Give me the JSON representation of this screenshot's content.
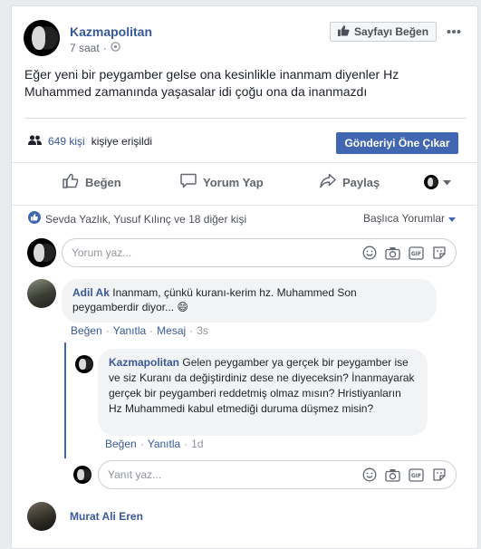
{
  "post": {
    "page_name": "Kazmapolitan",
    "time": "7 saat",
    "privacy_separator": "·",
    "privacy_icon": "globe-icon",
    "like_page_label": "Sayfayı Beğen",
    "more_icon": "more-dots-icon",
    "text": "Eğer yeni bir peygamber gelse ona kesinlikle inanmam diyenler Hz Muhammed zamanında yaşasalar idi çoğu ona da inanmazdı"
  },
  "reach": {
    "count": "649 kişi",
    "suffix": "kişiye erişildi",
    "boost_label": "Gönderiyi Öne Çıkar"
  },
  "actions": {
    "like": "Beğen",
    "comment": "Yorum Yap",
    "share": "Paylaş"
  },
  "reactions": {
    "text": "Sevda Yazlık, Yusuf Kılınç ve 18 diğer kişi",
    "sort_label": "Başlıca Yorumlar"
  },
  "composer": {
    "placeholder": "Yorum yaz..."
  },
  "comments": [
    {
      "author": "Adil Ak",
      "text": "Inanmam, çünkü kuranı-kerim hz. Muhammed Son peygamberdir diyor...",
      "emoji": "😄",
      "like": "Beğen",
      "reply": "Yanıtla",
      "message": "Mesaj",
      "time": "3s",
      "sep": "·"
    }
  ],
  "reply": {
    "author": "Kazmapolitan",
    "text": "Gelen peygamber ya gerçek bir peygamber ise ve siz Kuranı da değiştirdiniz dese ne diyeceksin? İnanmayarak gerçek bir peygamberi reddetmiş olmaz mısın? Hristiyanların Hz Muhammedi kabul etmediği duruma düşmez misin?",
    "like": "Beğen",
    "reply": "Yanıtla",
    "time": "1d",
    "sep": "·"
  },
  "reply_composer": {
    "placeholder": "Yanıt yaz..."
  },
  "next_comment": {
    "author": "Murat Ali Eren"
  },
  "colors": {
    "link": "#365899",
    "accent": "#4267b2",
    "background": "#e9ebee"
  }
}
